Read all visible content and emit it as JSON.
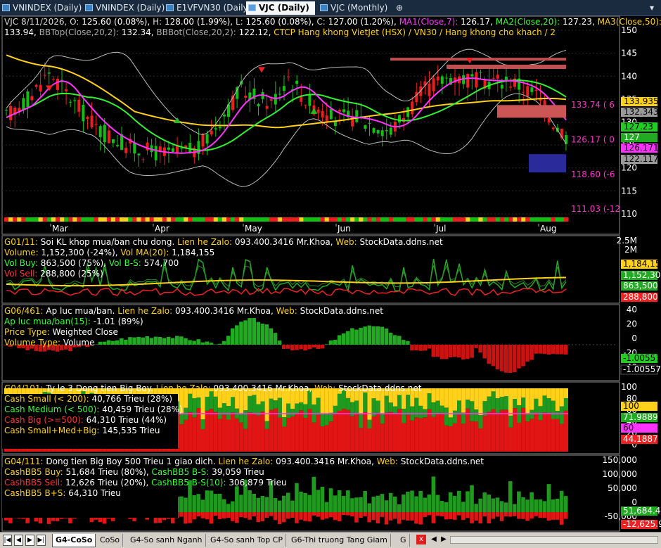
{
  "tabs": [
    {
      "label": "VNINDEX (Daily)",
      "active": false
    },
    {
      "label": "VNINDEX (Daily)",
      "active": false
    },
    {
      "label": "E1VFVN30 (Daily)",
      "active": false
    },
    {
      "label": "VJC (Daily)",
      "active": true
    },
    {
      "label": "VJC (Monthly)",
      "active": false
    }
  ],
  "tab_add_icon": "⊕",
  "main": {
    "info_line1": [
      {
        "t": "VJC 8/11/2026, ",
        "c": "#d8d8d8"
      },
      {
        "t": "O: ",
        "c": "#d8d8d8"
      },
      {
        "t": "125.60 (0.08%), ",
        "c": "#ffffff"
      },
      {
        "t": "H: ",
        "c": "#d8d8d8"
      },
      {
        "t": "128.00 (1.99%), ",
        "c": "#ffffff"
      },
      {
        "t": "L: ",
        "c": "#d8d8d8"
      },
      {
        "t": "125.60 (0.08%), ",
        "c": "#ffffff"
      },
      {
        "t": "C: ",
        "c": "#d8d8d8"
      },
      {
        "t": "127.00 (1.20%), ",
        "c": "#ffffff"
      },
      {
        "t": "MA1(Close,7): ",
        "c": "#ff33ff"
      },
      {
        "t": "126.17, ",
        "c": "#ffffff"
      },
      {
        "t": "MA2(Close,20): ",
        "c": "#33ff33"
      },
      {
        "t": "127.23, ",
        "c": "#ffffff"
      },
      {
        "t": "MA3(Close,50):",
        "c": "#ffd11a"
      }
    ],
    "info_line2": [
      {
        "t": "133.94, ",
        "c": "#ffffff"
      },
      {
        "t": "BBTop(Close,20,2): ",
        "c": "#aaaaaa"
      },
      {
        "t": "132.34, ",
        "c": "#ffffff"
      },
      {
        "t": "BBBot(Close,20,2): ",
        "c": "#aaaaaa"
      },
      {
        "t": "122.12, ",
        "c": "#ffffff"
      },
      {
        "t": "CTCP Hang khong VietJet (HSX) / VN30 / Hang khong cho khach / 2",
        "c": "#ffd11a"
      }
    ],
    "y_ticks": [
      "150",
      "145",
      "140",
      "135",
      "130",
      "125",
      "120",
      "115",
      "110"
    ],
    "months": [
      "Mar",
      "Apr",
      "May",
      "Jun",
      "Jul",
      "Aug"
    ],
    "right_labels": [
      {
        "text": "133.935",
        "bg": "#ffd11a",
        "fg": "#000000"
      },
      {
        "text": "132.343",
        "bg": "#9a9a9a",
        "fg": "#000000"
      },
      {
        "text": "127.23",
        "bg": "#22cc22",
        "fg": "#000000"
      },
      {
        "text": "127",
        "bg": "#22aa22",
        "fg": "#ffffff"
      },
      {
        "text": "126.171",
        "bg": "#ff33ff",
        "fg": "#000000"
      },
      {
        "text": "122.117",
        "bg": "#9a9a9a",
        "fg": "#000000"
      }
    ],
    "annotations": [
      {
        "text": "133.74 ( 6",
        "c": "#ff33cc"
      },
      {
        "text": "126.17 ( 0",
        "c": "#ff33cc"
      },
      {
        "text": "118.60 (-6",
        "c": "#ff33cc"
      },
      {
        "text": "111.03 (-12",
        "c": "#ff33cc"
      }
    ]
  },
  "panels": [
    {
      "id": "vol",
      "lines": [
        [
          {
            "t": "G01/11: ",
            "c": "#ffd11a"
          },
          {
            "t": "Soi KL khop mua/ban chu dong. ",
            "c": "#ffffff"
          },
          {
            "t": "Lien he Zalo: ",
            "c": "#ffd11a"
          },
          {
            "t": "093.400.3416 Mr.Khoa, ",
            "c": "#ffffff"
          },
          {
            "t": "Web: ",
            "c": "#ffd11a"
          },
          {
            "t": "StockData.ddns.net",
            "c": "#ffffff"
          }
        ],
        [
          {
            "t": "Volume: ",
            "c": "#ffd11a"
          },
          {
            "t": "1,152,300 (-24%), ",
            "c": "#ffffff"
          },
          {
            "t": "Vol MA(20): ",
            "c": "#ffd11a"
          },
          {
            "t": "1,184,155",
            "c": "#ffffff"
          }
        ],
        [
          {
            "t": "Vol Buy: ",
            "c": "#33ff33"
          },
          {
            "t": "863,500 (75%), ",
            "c": "#ffffff"
          },
          {
            "t": "Vol B-S: ",
            "c": "#33ff33"
          },
          {
            "t": "574,700",
            "c": "#ffffff"
          }
        ],
        [
          {
            "t": "Vol Sell: ",
            "c": "#ff3333"
          },
          {
            "t": "288,800 (25%)",
            "c": "#ffffff"
          }
        ]
      ],
      "y_ticks": [
        "2.5M",
        "2M"
      ],
      "right_labels": [
        {
          "text": "1,184,155",
          "bg": "#ffd11a",
          "fg": "#000000"
        },
        {
          "text": "1,152,300",
          "bg": "#22aa22",
          "fg": "#ffffff"
        },
        {
          "text": "863,500",
          "bg": "#22aa22",
          "fg": "#ffffff"
        },
        {
          "text": "288,800",
          "bg": "#ee2222",
          "fg": "#ffffff"
        }
      ]
    },
    {
      "id": "press",
      "lines": [
        [
          {
            "t": "G06/461: ",
            "c": "#ffd11a"
          },
          {
            "t": "Ap luc mua/ban. ",
            "c": "#ffffff"
          },
          {
            "t": "Lien he Zalo: ",
            "c": "#ffd11a"
          },
          {
            "t": "093.400.3416 Mr.Khoa, ",
            "c": "#ffffff"
          },
          {
            "t": "Web: ",
            "c": "#ffd11a"
          },
          {
            "t": "StockData.ddns.net",
            "c": "#ffffff"
          }
        ],
        [
          {
            "t": "Ap luc mua/ban(15): ",
            "c": "#33ff33"
          },
          {
            "t": "-1.01 (89%)",
            "c": "#ffffff"
          }
        ],
        [
          {
            "t": "Price Type: ",
            "c": "#ffd11a"
          },
          {
            "t": "Weighted Close",
            "c": "#ffffff"
          }
        ],
        [
          {
            "t": "Volume Type: ",
            "c": "#ffd11a"
          },
          {
            "t": "Volume",
            "c": "#ffffff"
          }
        ]
      ],
      "y_ticks": [
        "40",
        "20",
        "0",
        "-20",
        "-40"
      ],
      "right_labels": [
        {
          "text": "-1.00557",
          "bg": "#22cc22",
          "fg": "#000000"
        },
        {
          "text": "-1.00557",
          "bg": "#000000",
          "fg": "#ffffff"
        }
      ]
    },
    {
      "id": "cash",
      "lines": [
        [
          {
            "t": "G04/101: ",
            "c": "#ffd11a"
          },
          {
            "t": "Ty le 3 Dong tien Big Boy. ",
            "c": "#ffffff"
          },
          {
            "t": "Lien he Zalo: ",
            "c": "#ffd11a"
          },
          {
            "t": "093.400.3416 Mr.Khoa, ",
            "c": "#ffffff"
          },
          {
            "t": "Web: ",
            "c": "#ffd11a"
          },
          {
            "t": "StockData.ddns.net",
            "c": "#ffffff"
          }
        ],
        [
          {
            "t": "Cash Small (< 200): ",
            "c": "#ffd11a"
          },
          {
            "t": "40,766 Trieu (28%)",
            "c": "#ffffff"
          }
        ],
        [
          {
            "t": "Cash Medium (< 500): ",
            "c": "#33ff33"
          },
          {
            "t": "40,459 Trieu (28%)",
            "c": "#ffffff"
          }
        ],
        [
          {
            "t": "Cash Big (>=500): ",
            "c": "#ff3333"
          },
          {
            "t": "64,310 Trieu (44%)",
            "c": "#ffffff"
          }
        ],
        [
          {
            "t": "Cash Small+Med+Big: ",
            "c": "#ffd11a"
          },
          {
            "t": "145,535 Trieu",
            "c": "#ffffff"
          }
        ]
      ],
      "y_ticks": [
        "100",
        "80",
        "60",
        "40",
        "20",
        "0"
      ],
      "right_labels": [
        {
          "text": "100",
          "bg": "#ffd11a",
          "fg": "#000000"
        },
        {
          "text": "71.9889",
          "bg": "#22aa22",
          "fg": "#ffffff"
        },
        {
          "text": "60",
          "bg": "#ff33ff",
          "fg": "#000000"
        },
        {
          "text": "44.1887",
          "bg": "#ee2222",
          "fg": "#ffffff"
        }
      ]
    },
    {
      "id": "bb5",
      "lines": [
        [
          {
            "t": "G04/111: ",
            "c": "#ffd11a"
          },
          {
            "t": "Dong tien Big Boy 500 Trieu 1 giao dich. ",
            "c": "#ffffff"
          },
          {
            "t": "Lien he Zalo: ",
            "c": "#ffd11a"
          },
          {
            "t": "093.400.3416 Mr.Khoa, ",
            "c": "#ffffff"
          },
          {
            "t": "Web: ",
            "c": "#ffd11a"
          },
          {
            "t": "StockData.ddns.net",
            "c": "#ffffff"
          }
        ],
        [
          {
            "t": "CashBB5 Buy: ",
            "c": "#ffd11a"
          },
          {
            "t": "51,684 Trieu (80%), ",
            "c": "#ffffff"
          },
          {
            "t": "CashBB5 B-S: ",
            "c": "#33ff33"
          },
          {
            "t": "39,059 Trieu",
            "c": "#ffffff"
          }
        ],
        [
          {
            "t": "CashBB5 Sell: ",
            "c": "#ff3333"
          },
          {
            "t": "12,626 Trieu (20%), ",
            "c": "#ffffff"
          },
          {
            "t": "CashBB5 B-S(10): ",
            "c": "#33ff33"
          },
          {
            "t": "306,879 Trieu",
            "c": "#ffffff"
          }
        ],
        [
          {
            "t": "CashBB5 B+S: ",
            "c": "#ffd11a"
          },
          {
            "t": "64,310 Trieu",
            "c": "#ffffff"
          }
        ]
      ],
      "y_ticks": [
        "150,000",
        "100,000",
        "50,000",
        "0",
        "-50,000"
      ],
      "right_labels": [
        {
          "text": "51,684.4",
          "bg": "#22aa22",
          "fg": "#ffffff"
        },
        {
          "text": "-12,625.9",
          "bg": "#ee2222",
          "fg": "#ffffff"
        }
      ]
    }
  ],
  "bottom_tabs": [
    {
      "label": "G4-CoSo",
      "active": true
    },
    {
      "label": "CoSo",
      "active": false
    },
    {
      "label": "G4-So sanh Nganh",
      "active": false
    },
    {
      "label": "G4-So sanh Top CP",
      "active": false
    },
    {
      "label": "G6-Thi truong Tang Giam",
      "active": false
    },
    {
      "label": "G",
      "active": false
    }
  ],
  "nav_icons": [
    "|◀",
    "◀",
    "▶",
    "▶|"
  ],
  "scroll_icons": [
    "x",
    "◀",
    "▶"
  ]
}
